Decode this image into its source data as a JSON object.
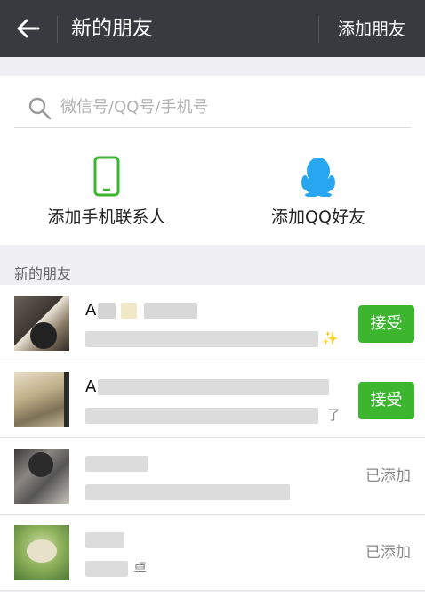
{
  "header": {
    "title": "新的朋友",
    "add_friend_label": "添加朋友"
  },
  "search": {
    "placeholder": "微信号/QQ号/手机号"
  },
  "quick_actions": [
    {
      "label": "添加手机联系人",
      "icon": "phone-icon"
    },
    {
      "label": "添加QQ好友",
      "icon": "qq-penguin-icon"
    }
  ],
  "section": {
    "label": "新的朋友"
  },
  "friends": [
    {
      "action_label": "接受",
      "action_type": "accept",
      "name_visible": "A",
      "message_visible": "✨"
    },
    {
      "action_label": "接受",
      "action_type": "accept",
      "name_visible": "A",
      "message_visible": "了"
    },
    {
      "action_label": "已添加",
      "action_type": "added",
      "name_visible": "",
      "message_visible": ""
    },
    {
      "action_label": "已添加",
      "action_type": "added",
      "name_visible": "",
      "message_visible": "卓"
    }
  ],
  "colors": {
    "topbar": "#393a3f",
    "accent_green": "#3cb52f",
    "phone_green": "#3cb52f",
    "qq_blue": "#29a6f0"
  }
}
